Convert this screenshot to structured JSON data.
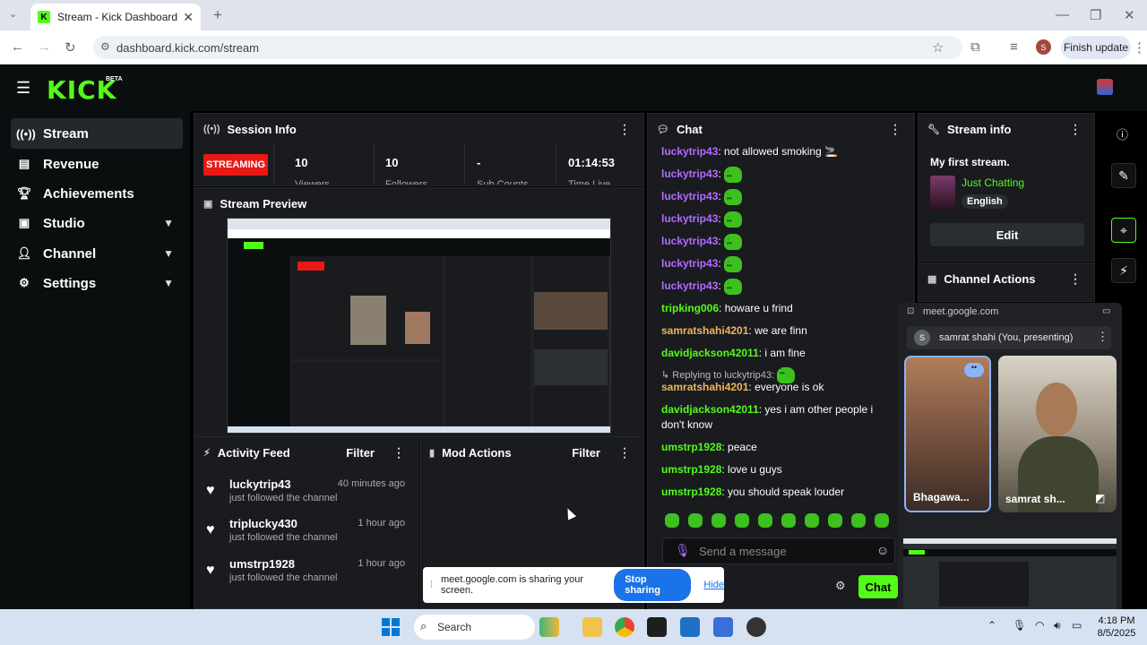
{
  "browser": {
    "tab_title": "Stream - Kick Dashboard",
    "url": "dashboard.kick.com/stream",
    "finish_update": "Finish update",
    "profile_initial": "S"
  },
  "brand": {
    "logo": "KICK",
    "beta": "BETA"
  },
  "sidebar": {
    "items": [
      {
        "label": "Stream",
        "icon": "broadcast-icon"
      },
      {
        "label": "Revenue",
        "icon": "chart-icon"
      },
      {
        "label": "Achievements",
        "icon": "trophy-icon"
      },
      {
        "label": "Studio",
        "icon": "camera-icon"
      },
      {
        "label": "Channel",
        "icon": "person-icon"
      },
      {
        "label": "Settings",
        "icon": "gear-icon"
      }
    ]
  },
  "session": {
    "title": "Session Info",
    "status": "STREAMING",
    "viewers": "10",
    "viewers_label": "Viewers",
    "followers": "10",
    "followers_label": "Followers",
    "subs": "-",
    "subs_label": "Sub Counts",
    "time": "01:14:53",
    "time_label": "Time Live"
  },
  "preview": {
    "title": "Stream Preview"
  },
  "activity": {
    "title": "Activity Feed",
    "filter": "Filter",
    "items": [
      {
        "name": "luckytrip43",
        "time": "40 minutes ago",
        "sub": "just followed the channel"
      },
      {
        "name": "triplucky430",
        "time": "1 hour ago",
        "sub": "just followed the channel"
      },
      {
        "name": "umstrp1928",
        "time": "1 hour ago",
        "sub": "just followed the channel"
      }
    ]
  },
  "mod": {
    "title": "Mod Actions",
    "filter": "Filter"
  },
  "chat": {
    "title": "Chat",
    "messages": [
      {
        "user": "luckytrip43",
        "color": "#b36bff",
        "text": "not allowed smoking 🚬"
      },
      {
        "user": "luckytrip43",
        "color": "#b36bff",
        "text": ""
      },
      {
        "user": "luckytrip43",
        "color": "#b36bff",
        "text": ""
      },
      {
        "user": "luckytrip43",
        "color": "#b36bff",
        "text": ""
      },
      {
        "user": "luckytrip43",
        "color": "#b36bff",
        "text": ""
      },
      {
        "user": "luckytrip43",
        "color": "#b36bff",
        "text": ""
      },
      {
        "user": "luckytrip43",
        "color": "#b36bff",
        "text": ""
      },
      {
        "user": "tripking006",
        "color": "#53fc18",
        "text": "howare u frind"
      },
      {
        "user": "samratshahi4201",
        "color": "#f2b35b",
        "text": "we are finn"
      },
      {
        "user": "davidjackson42011",
        "color": "#53fc18",
        "text": "i am fine"
      },
      {
        "user": "samratshahi4201",
        "color": "#f2b35b",
        "text": "everyone is ok"
      },
      {
        "user": "davidjackson42011",
        "color": "#53fc18",
        "text": "yes i am other people i don't know"
      },
      {
        "user": "umstrp1928",
        "color": "#53fc18",
        "text": "peace"
      },
      {
        "user": "umstrp1928",
        "color": "#53fc18",
        "text": "love u guys"
      },
      {
        "user": "umstrp1928",
        "color": "#53fc18",
        "text": "you should speak louder"
      }
    ],
    "reply_label": "↳ Replying to luckytrip43:",
    "placeholder": "Send a message",
    "send": "Chat"
  },
  "stream_info": {
    "title": "Stream info",
    "stream_title": "My first stream.",
    "category": "Just Chatting",
    "language": "English",
    "edit": "Edit",
    "channel_actions": "Channel Actions"
  },
  "meet": {
    "url": "meet.google.com",
    "presenter": "samrat shahi (You, presenting)",
    "presenter_initial": "S",
    "tile1": "Bhagawa...",
    "tile2": "samrat sh..."
  },
  "share_bar": {
    "text": "meet.google.com is sharing your screen.",
    "stop": "Stop sharing",
    "hide": "Hide"
  },
  "taskbar": {
    "search": "Search",
    "time": "4:18 PM",
    "date": "8/5/2025"
  },
  "colors": {
    "accent": "#53fc18",
    "live": "#e91916",
    "panel": "#191b1f"
  }
}
